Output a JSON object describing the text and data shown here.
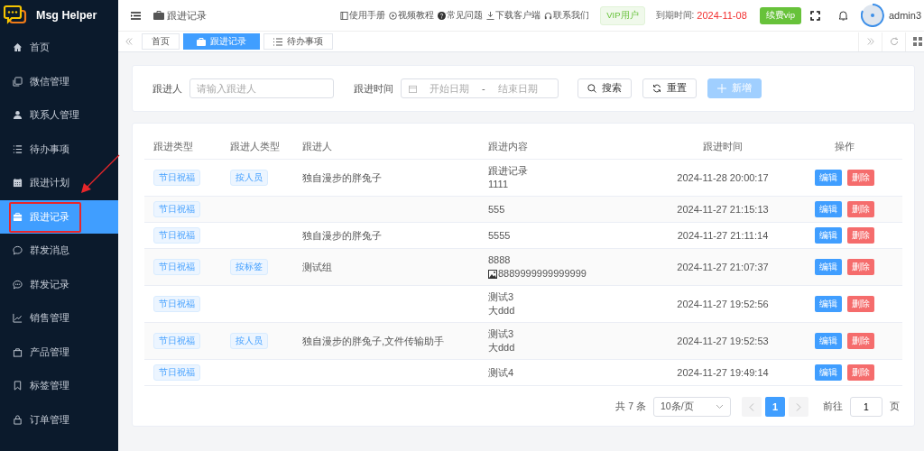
{
  "app": {
    "name": "Msg Helper"
  },
  "sidebar": {
    "items": [
      {
        "label": "首页",
        "selected": false
      },
      {
        "label": "微信管理",
        "selected": false
      },
      {
        "label": "联系人管理",
        "selected": false
      },
      {
        "label": "待办事项",
        "selected": false
      },
      {
        "label": "跟进计划",
        "selected": false
      },
      {
        "label": "跟进记录",
        "selected": true
      },
      {
        "label": "群发消息",
        "selected": false
      },
      {
        "label": "群发记录",
        "selected": false
      },
      {
        "label": "销售管理",
        "selected": false
      },
      {
        "label": "产品管理",
        "selected": false
      },
      {
        "label": "标签管理",
        "selected": false
      },
      {
        "label": "订单管理",
        "selected": false
      }
    ]
  },
  "header": {
    "breadcrumb": "跟进记录",
    "links": [
      "使用手册",
      "视频教程",
      "常见问题",
      "下载客户端",
      "联系我们"
    ],
    "vip_badge": "VIP用户",
    "expiry_label": "到期时间:",
    "expiry_date": "2024-11-08",
    "renew_button": "续费vip",
    "user": "admin3"
  },
  "tabs": [
    {
      "label": "首页",
      "selected": false
    },
    {
      "label": "跟进记录",
      "selected": true
    },
    {
      "label": "待办事项",
      "selected": false
    }
  ],
  "filters": {
    "person_label": "跟进人",
    "person_placeholder": "请输入跟进人",
    "time_label": "跟进时间",
    "start_placeholder": "开始日期",
    "separator": "-",
    "end_placeholder": "结束日期",
    "buttons": [
      {
        "label": "搜索",
        "kind": "search"
      },
      {
        "label": "重置",
        "kind": "reset"
      },
      {
        "label": "新增",
        "kind": "add",
        "disabled": true
      }
    ]
  },
  "table": {
    "columns": [
      "跟进类型",
      "跟进人类型",
      "跟进人",
      "跟进内容",
      "跟进时间",
      "操作"
    ],
    "rows": [
      {
        "type": "节日祝福",
        "person_type": "按人员",
        "person": "独自漫步的胖兔子",
        "content": [
          {
            "kind": "text",
            "text": "跟进记录"
          },
          {
            "kind": "text",
            "text": "1111"
          }
        ],
        "time": "2024-11-28 20:00:17",
        "actions": [
          "编辑",
          "删除"
        ]
      },
      {
        "type": "节日祝福",
        "content": [
          {
            "kind": "text",
            "text": "555"
          }
        ],
        "time": "2024-11-27 21:15:13",
        "actions": [
          "编辑",
          "删除"
        ]
      },
      {
        "type": "节日祝福",
        "person": "独自漫步的胖兔子",
        "content": [
          {
            "kind": "text",
            "text": "5555"
          }
        ],
        "time": "2024-11-27 21:11:14",
        "actions": [
          "编辑",
          "删除"
        ]
      },
      {
        "type": "节日祝福",
        "person_type": "按标签",
        "person": "测试组",
        "content": [
          {
            "kind": "text",
            "text": "8888"
          },
          {
            "kind": "image",
            "text": "8889999999999999"
          }
        ],
        "time": "2024-11-27 21:07:37",
        "actions": [
          "编辑",
          "删除"
        ]
      },
      {
        "type": "节日祝福",
        "content": [
          {
            "kind": "text",
            "text": "测试3"
          },
          {
            "kind": "text",
            "text": "大ddd"
          }
        ],
        "time": "2024-11-27 19:52:56",
        "actions": [
          "编辑",
          "删除"
        ]
      },
      {
        "type": "节日祝福",
        "person_type": "按人员",
        "person": "独自漫步的胖兔子,文件传输助手",
        "content": [
          {
            "kind": "text",
            "text": "测试3"
          },
          {
            "kind": "text",
            "text": "大ddd"
          }
        ],
        "time": "2024-11-27 19:52:53",
        "actions": [
          "编辑",
          "删除"
        ]
      },
      {
        "type": "节日祝福",
        "content": [
          {
            "kind": "text",
            "text": "测试4"
          }
        ],
        "time": "2024-11-27 19:49:14",
        "actions": [
          "编辑",
          "删除"
        ]
      }
    ]
  },
  "pagination": {
    "total": "共 7 条",
    "page_size": "10条/页",
    "pages": [
      {
        "label": "1",
        "selected": true
      }
    ],
    "goto_label": "前往",
    "goto_value": "1",
    "page_suffix": "页"
  }
}
